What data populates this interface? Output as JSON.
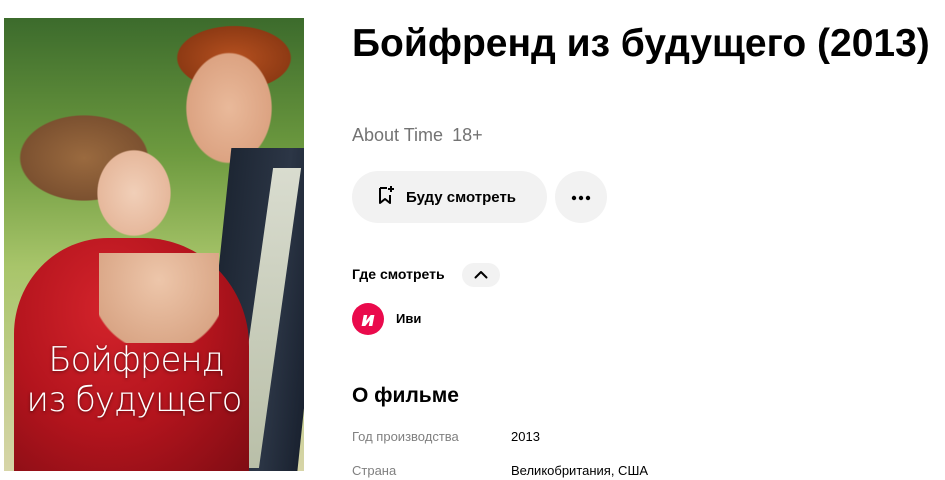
{
  "movie": {
    "title": "Бойфренд из будущего (2013)",
    "original_title": "About Time",
    "age_rating": "18+",
    "poster": {
      "title_line1": "Бойфренд",
      "title_line2": "из будущего"
    }
  },
  "actions": {
    "watch_later_label": "Буду смотреть",
    "watch_later_icon": "bookmark-plus-icon",
    "more_icon": "ellipsis-icon"
  },
  "where_to_watch": {
    "heading": "Где смотреть",
    "toggle_icon": "chevron-up-icon",
    "providers": [
      {
        "logo_text": "и",
        "name": "Иви",
        "color": "#ea0a4c"
      }
    ]
  },
  "about": {
    "heading": "О фильме",
    "rows": [
      {
        "label": "Год производства",
        "value": "2013"
      },
      {
        "label": "Страна",
        "value": "Великобритания, США"
      }
    ]
  }
}
